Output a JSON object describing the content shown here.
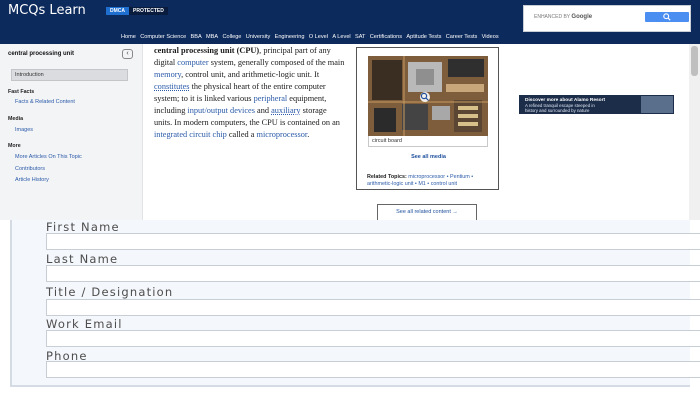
{
  "header": {
    "logo": "MCQs Learn",
    "badge_left": "DMCA",
    "badge_right": "PROTECTED",
    "search_prefix": "ENHANCED BY",
    "search_brand": "Google",
    "nav": [
      "Home",
      "Computer Science",
      "BBA",
      "MBA",
      "College",
      "University",
      "Engineering",
      "O Level",
      "A Level",
      "SAT",
      "Certifications",
      "Aptitude Tests",
      "Career Tests",
      "Videos"
    ]
  },
  "sidebar": {
    "title": "central processing unit",
    "toggle": "‹",
    "active": "Introduction",
    "sections": [
      {
        "heading": "Fast Facts",
        "items": [
          "Facts & Related Content"
        ]
      },
      {
        "heading": "Media",
        "items": [
          "Images"
        ]
      },
      {
        "heading": "More",
        "items": [
          "More Articles On This Topic",
          "Contributors",
          "Article History"
        ]
      }
    ]
  },
  "article": {
    "lead": "central processing unit (CPU)",
    "t1": ", principal part of any digital ",
    "l1": "computer",
    "t2": " system, generally composed of the main ",
    "l2": "memory",
    "t3": ", control unit, and arithmetic-logic unit. It ",
    "l3": "constitutes",
    "t4": " the physical heart of the entire computer system; to it is linked various ",
    "l4": "peripheral",
    "t5": " equipment, including ",
    "l5": "input/output devices",
    "t6": " and ",
    "l6": "auxiliary",
    "t7": " storage units. In modern computers, the CPU is contained on an ",
    "l7": "integrated circuit chip",
    "t8": " called a ",
    "l8": "microprocessor",
    "t9": "."
  },
  "media": {
    "caption": "circuit board",
    "see_all": "See all media",
    "related_label": "Related Topics:",
    "related_links": "microprocessor • Pentium • arithmetic-logic unit • M1 • control unit",
    "see_all_related": "See all related content →"
  },
  "ad": {
    "line1": "Discover more about Alamo Resort",
    "line2": "A refined tranquil escape steeped in",
    "line3": "history and surrounded by nature"
  },
  "form": {
    "fields": [
      "First Name",
      "Last Name",
      "Title / Designation",
      "Work Email",
      "Phone"
    ]
  },
  "colors": {
    "header_bg": "#0d2a5c",
    "link": "#2a5aa8",
    "form_bg": "#f4f7fb"
  }
}
